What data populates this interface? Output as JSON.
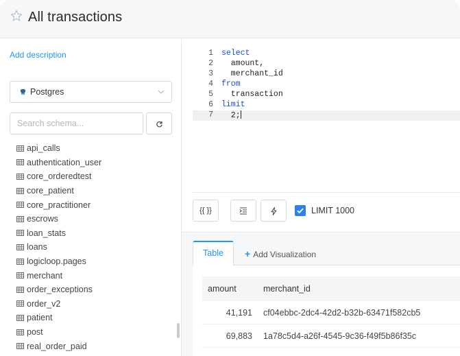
{
  "header": {
    "title": "All transactions",
    "star_icon": "star-outline-icon"
  },
  "left_panel": {
    "add_description_label": "Add description",
    "data_source": {
      "label": "Postgres",
      "icon": "postgres-elephant-icon"
    },
    "schema_search": {
      "placeholder": "Search schema...",
      "value": ""
    },
    "refresh_icon": "refresh-icon",
    "table_icon": "table-grid-icon",
    "schema_items": [
      "api_calls",
      "authentication_user",
      "core_orderedtest",
      "core_patient",
      "core_practitioner",
      "escrows",
      "loan_stats",
      "loans",
      "logicloop.pages",
      "merchant",
      "order_exceptions",
      "order_v2",
      "patient",
      "post",
      "real_order_paid"
    ]
  },
  "editor": {
    "lines": [
      {
        "num": "1",
        "text": "select",
        "kind": "keyword"
      },
      {
        "num": "2",
        "text": "  amount,",
        "kind": "plain"
      },
      {
        "num": "3",
        "text": "  merchant_id",
        "kind": "plain"
      },
      {
        "num": "4",
        "text": "from",
        "kind": "keyword"
      },
      {
        "num": "5",
        "text": "  transaction",
        "kind": "plain"
      },
      {
        "num": "6",
        "text": "limit",
        "kind": "keyword"
      },
      {
        "num": "7",
        "text": "  2;",
        "kind": "plain"
      }
    ],
    "active_line": 7
  },
  "toolbar": {
    "params_label": "{{ }}",
    "format_icon": "indent-format-icon",
    "autocomplete_icon": "lightning-icon",
    "limit_checked": true,
    "limit_label": "LIMIT 1000"
  },
  "results": {
    "tabs": {
      "table_label": "Table",
      "add_visualization_label": "Add Visualization"
    },
    "columns": [
      "amount",
      "merchant_id"
    ],
    "rows": [
      {
        "amount": "41,191",
        "merchant_id": "cf04ebbc-2dc4-42d2-b32b-63471f582cb5"
      },
      {
        "amount": "69,883",
        "merchant_id": "1a78c5d4-a26f-4545-9c36-f49f5b86f35c"
      }
    ]
  },
  "colors": {
    "accent": "#2196f3",
    "keyword": "#1a4ccf",
    "checkbox": "#2f80ed",
    "header_bg": "#f6f7f9"
  }
}
